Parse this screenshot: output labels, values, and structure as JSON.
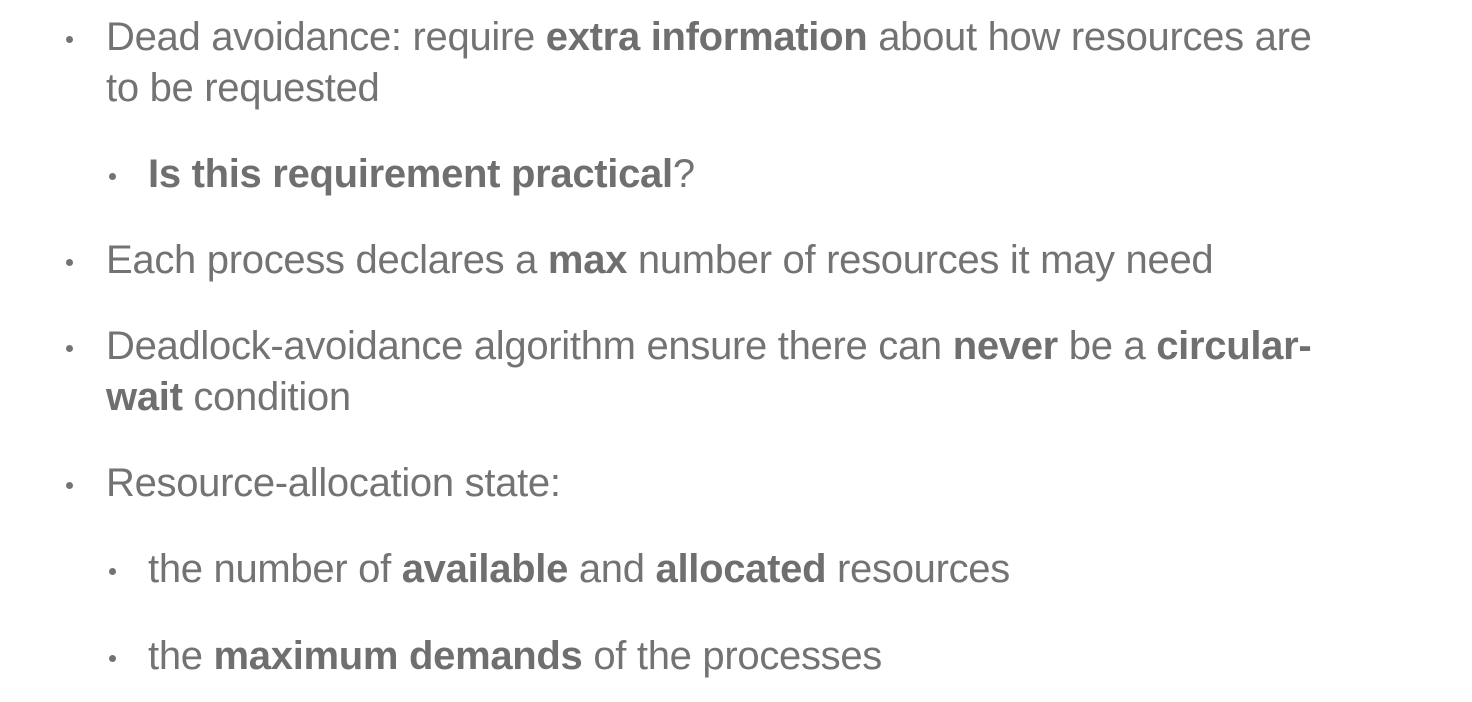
{
  "bullets": [
    {
      "level": 1,
      "lines": [
        [
          {
            "text": "Dead avoidance: require ",
            "bold": false
          },
          {
            "text": "extra information",
            "bold": true
          },
          {
            "text": " about how resources are",
            "bold": false
          }
        ],
        [
          {
            "text": "to be requested",
            "bold": false
          }
        ]
      ]
    },
    {
      "level": 2,
      "lines": [
        [
          {
            "text": "Is this requirement practical",
            "bold": true
          },
          {
            "text": "?",
            "bold": false
          }
        ]
      ]
    },
    {
      "level": 1,
      "lines": [
        [
          {
            "text": "Each process declares a ",
            "bold": false
          },
          {
            "text": "max",
            "bold": true
          },
          {
            "text": " number of resources it may need",
            "bold": false
          }
        ]
      ]
    },
    {
      "level": 1,
      "lines": [
        [
          {
            "text": "Deadlock-avoidance algorithm ensure there can ",
            "bold": false
          },
          {
            "text": "never",
            "bold": true
          },
          {
            "text": " be a ",
            "bold": false
          },
          {
            "text": "circular-",
            "bold": true
          }
        ],
        [
          {
            "text": "wait",
            "bold": true
          },
          {
            "text": " condition",
            "bold": false
          }
        ]
      ]
    },
    {
      "level": 1,
      "lines": [
        [
          {
            "text": "Resource-allocation state:",
            "bold": false
          }
        ]
      ]
    },
    {
      "level": 2,
      "lines": [
        [
          {
            "text": "the number of ",
            "bold": false
          },
          {
            "text": "available",
            "bold": true
          },
          {
            "text": " and ",
            "bold": false
          },
          {
            "text": "allocated",
            "bold": true
          },
          {
            "text": " resources",
            "bold": false
          }
        ]
      ]
    },
    {
      "level": 2,
      "lines": [
        [
          {
            "text": "the ",
            "bold": false
          },
          {
            "text": "maximum demands",
            "bold": true
          },
          {
            "text": " of the processes",
            "bold": false
          }
        ]
      ]
    }
  ]
}
